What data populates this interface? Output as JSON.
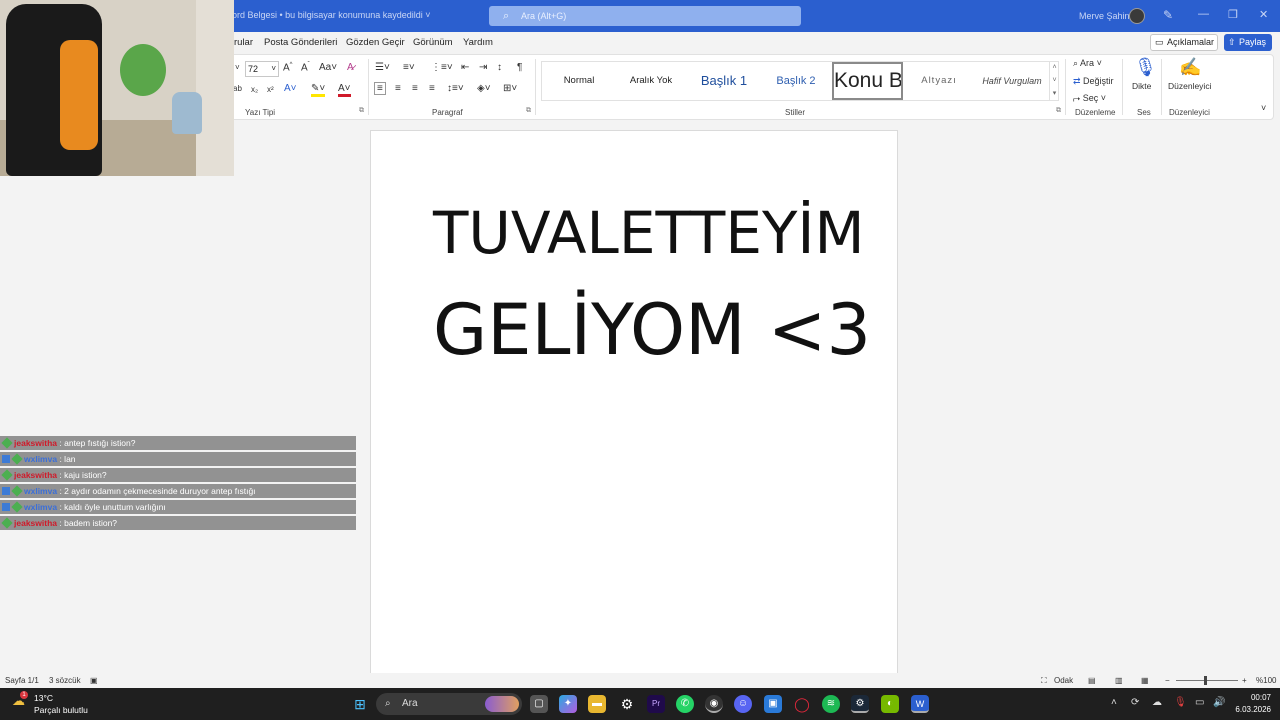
{
  "titlebar": {
    "doc_title": "ord Belgesi  •  bu bilgisayar konumuna kaydedildi  ˅",
    "search_placeholder": "Ara (Alt+G)",
    "user_name": "Merve Şahin"
  },
  "menu": {
    "tabs": [
      "rular",
      "Posta Gönderileri",
      "Gözden Geçir",
      "Görünüm",
      "Yardım"
    ],
    "comments_label": "Açıklamalar",
    "share_label": "Paylaş"
  },
  "ribbon": {
    "font_size": "72",
    "groups": {
      "font": "Yazı Tipi",
      "paragraph": "Paragraf",
      "styles": "Stiller",
      "editing": "Düzenleme",
      "voice": "Ses",
      "editor": "Düzenleyici"
    },
    "styles": [
      "Normal",
      "Aralık Yok",
      "Başlık 1",
      "Başlık 2",
      "Konu B",
      "Altyazı",
      "Hafif Vurgulam"
    ],
    "editing": {
      "find": "Ara",
      "replace": "Değiştir",
      "select": "Seç"
    },
    "dictate": "Dikte",
    "editor_btn": "Düzenleyici"
  },
  "document": {
    "line1": "TUVALETTEYİM",
    "line2": "GELİYOM <3"
  },
  "chat": [
    {
      "user": "jeakswitha",
      "user_color": "red",
      "badges": [
        "green"
      ],
      "message": ": antep fıstığı istion?"
    },
    {
      "user": "wxlimva",
      "user_color": "blue",
      "badges": [
        "blue",
        "green"
      ],
      "message": ": lan"
    },
    {
      "user": "jeakswitha",
      "user_color": "red",
      "badges": [
        "green"
      ],
      "message": ": kaju istion?"
    },
    {
      "user": "wxlimva",
      "user_color": "blue",
      "badges": [
        "blue",
        "green"
      ],
      "message": ": 2 aydır odamın çekmecesinde duruyor antep fıstığı"
    },
    {
      "user": "wxlimva",
      "user_color": "blue",
      "badges": [
        "blue",
        "green"
      ],
      "message": ": kaldı öyle unuttum varlığını"
    },
    {
      "user": "jeakswitha",
      "user_color": "red",
      "badges": [
        "green"
      ],
      "message": ": badem istion?"
    }
  ],
  "statusbar": {
    "page": "Sayfa 1/1",
    "words": "3 sözcük",
    "focus": "Odak",
    "zoom": "%100"
  },
  "taskbar": {
    "weather_badge": "1",
    "temperature": "13°C",
    "weather": "Parçalı bulutlu",
    "search": "Ara",
    "time": "00:07",
    "date": "6.03.2026"
  },
  "colors": {
    "accent": "#2b5fcf",
    "chat_red": "#d01a2a",
    "chat_blue": "#3b6fd9"
  }
}
